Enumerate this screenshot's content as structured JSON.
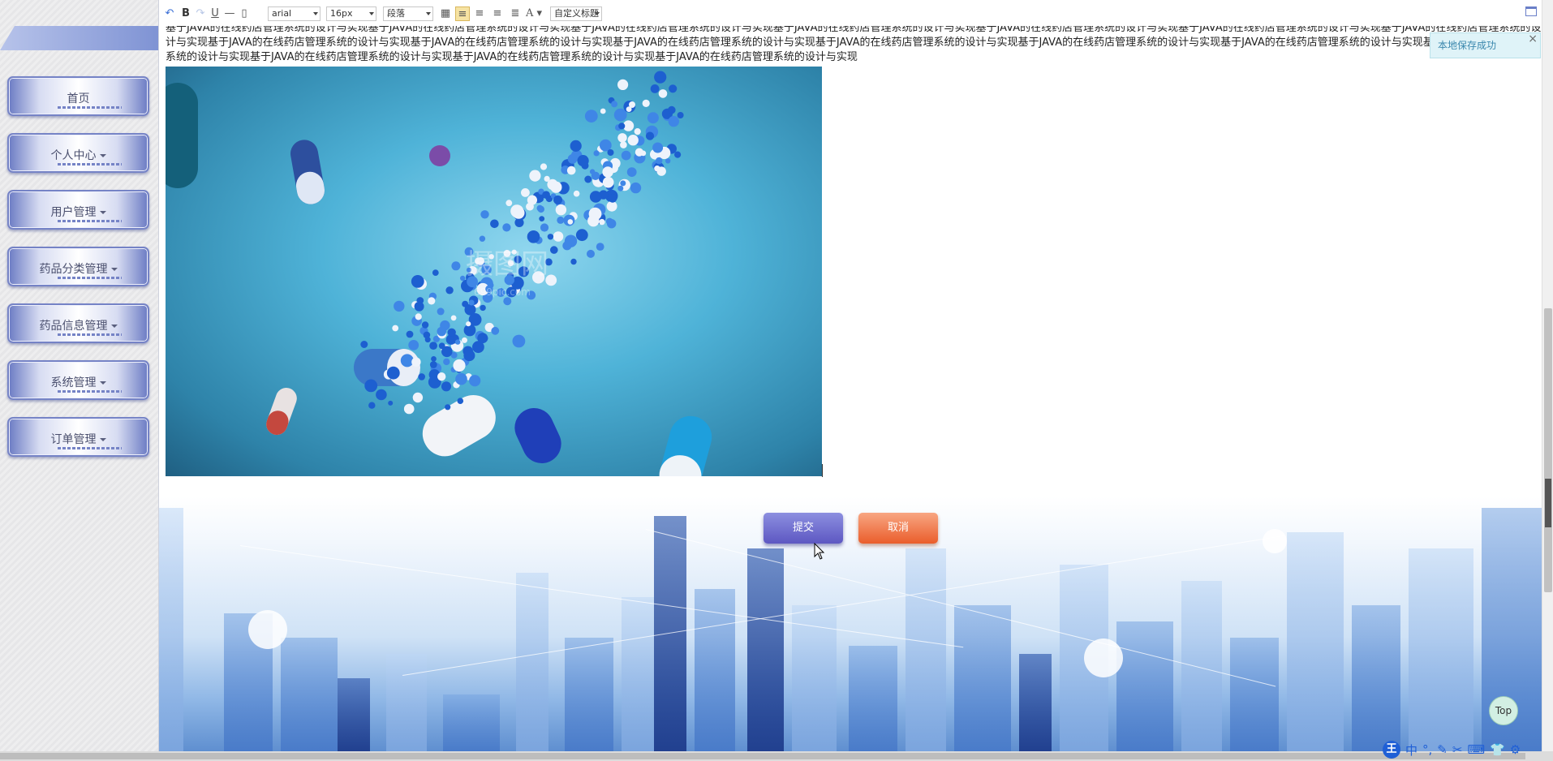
{
  "sidebar": {
    "items": [
      {
        "label": "首页",
        "has_caret": false
      },
      {
        "label": "个人中心",
        "has_caret": true
      },
      {
        "label": "用户管理",
        "has_caret": true
      },
      {
        "label": "药品分类管理",
        "has_caret": true
      },
      {
        "label": "药品信息管理",
        "has_caret": true
      },
      {
        "label": "系统管理",
        "has_caret": true
      },
      {
        "label": "订单管理",
        "has_caret": true
      }
    ]
  },
  "toolbar": {
    "bold": "B",
    "underline": "U",
    "font_family": "arial",
    "font_size": "16px",
    "paragraph": "段落",
    "font_color": "A",
    "custom_title": "自定义标题"
  },
  "editor": {
    "text": "基于JAVA的在线药店管理系统的设计与实现基于JAVA的在线药店管理系统的设计与实现基于JAVA的在线药店管理系统的设计与实现基于JAVA的在线药店管理系统的设计与实现基于JAVA的在线药店管理系统的设计与实现基于JAVA的在线药店管理系统的设计与实现基于JAVA的在线药店管理系统的设计与实现基于JAVA的在线药店管理系统的设计与实现基于JAVA的在线药店管理系统的设计与实现基于JAVA的在线药店管理系统的设计与实现基于JAVA的在线药店管理系统的设计与实现基于JAVA的在线药店管理系统的设计与实现基于JAVA的在线药店管理系统的设计与实现基于JAVA的在线药店管理系统的设计与实现基于JAVA的在线药店管理系统的设计与实现基于JAVA的在线药店管理系统的设计与实现基于JAVA的在线药店管理系统的设计与实现",
    "image_watermark": "摄图网",
    "image_watermark_sub": "699pic.com"
  },
  "toast": {
    "message": "本地保存成功",
    "close": "×"
  },
  "actions": {
    "submit_label": "提交",
    "cancel_label": "取消"
  },
  "back_to_top": "Top",
  "ime": {
    "logo": "王",
    "mode": "中"
  },
  "colors": {
    "submit": "#5d57c2",
    "cancel": "#ea5d2b",
    "menu_border": "#7583c6",
    "toast_text": "#3a87ad"
  }
}
